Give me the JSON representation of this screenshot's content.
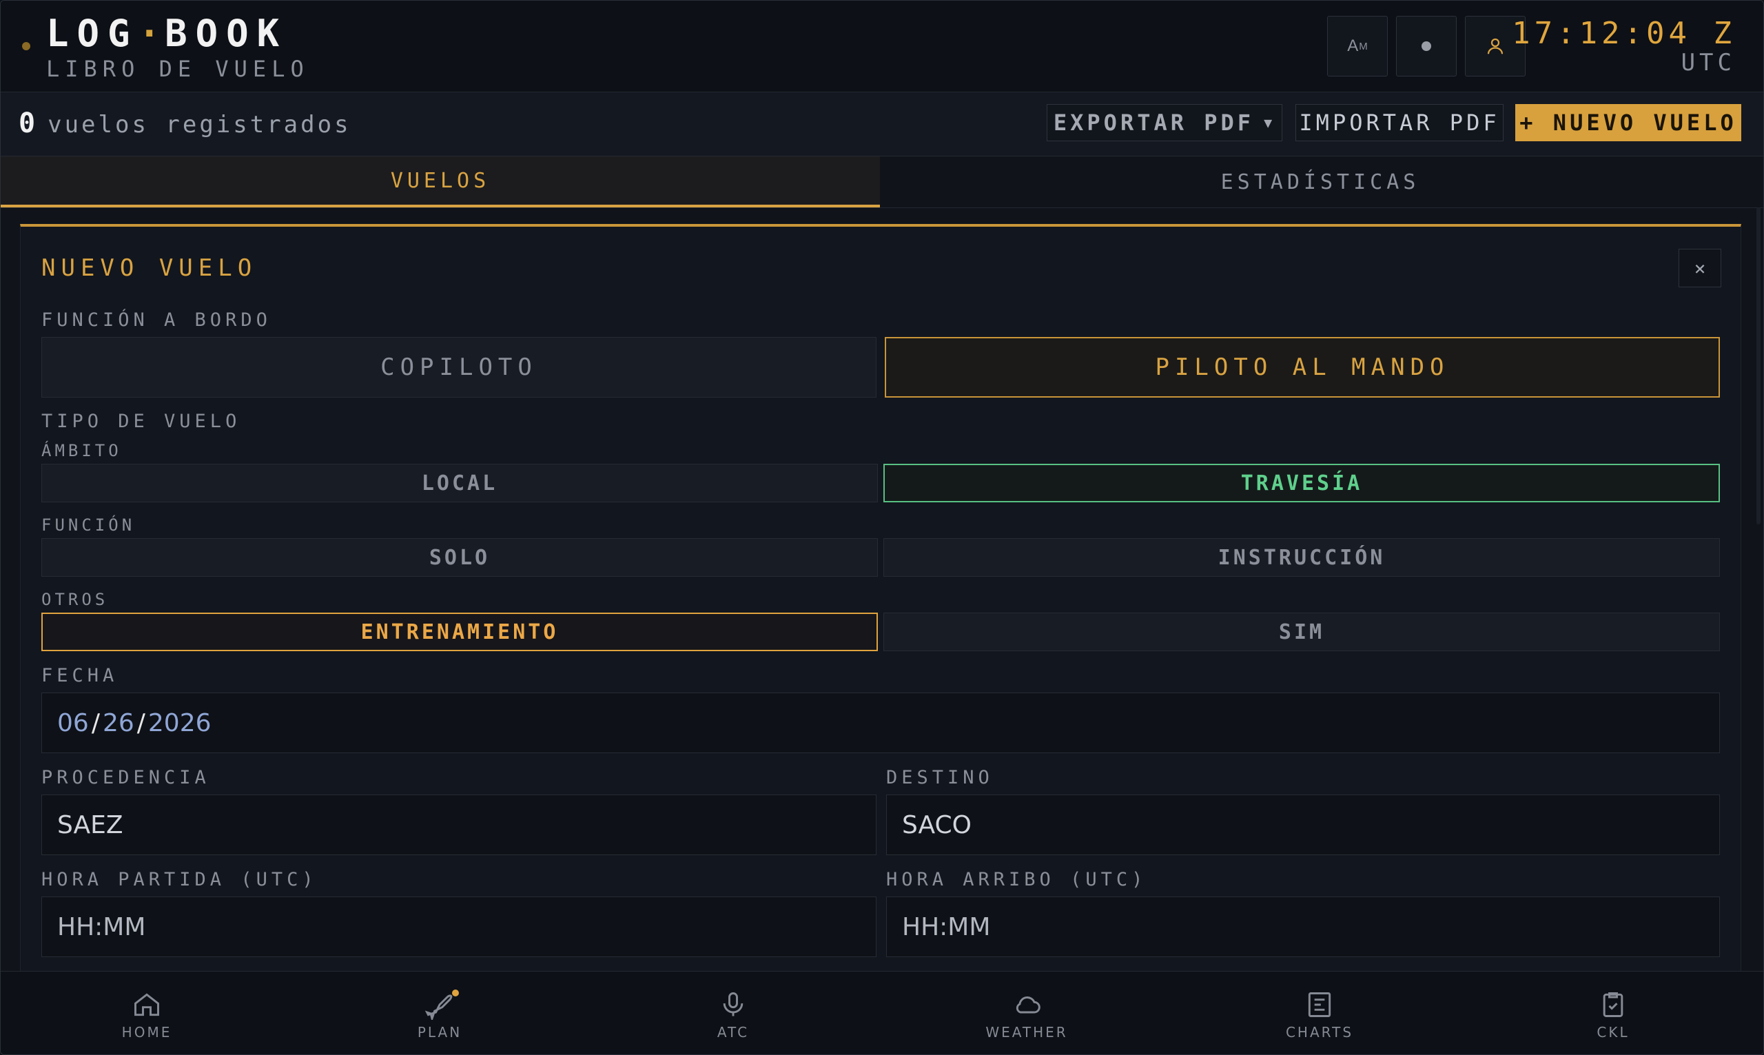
{
  "header": {
    "title_left": "LOG",
    "title_sep": "·",
    "title_right": "BOOK",
    "subtitle": "LIBRO DE VUELO",
    "font_button": {
      "big": "A",
      "small": "M"
    },
    "clock": "17:12:04 Z",
    "clock_zone": "UTC"
  },
  "toolbar": {
    "count": "0",
    "count_label": "vuelos registrados",
    "export_label": "EXPORTAR PDF",
    "export_caret": "▼",
    "import_label": "IMPORTAR PDF",
    "new_label": "+ NUEVO VUELO"
  },
  "tabs": [
    {
      "label": "VUELOS",
      "active": true
    },
    {
      "label": "ESTADÍSTICAS",
      "active": false
    }
  ],
  "form": {
    "title": "NUEVO VUELO",
    "close": "×",
    "role_label": "FUNCIÓN A BORDO",
    "roles": [
      {
        "label": "COPILOTO",
        "selected": false
      },
      {
        "label": "PILOTO AL MANDO",
        "selected": true
      }
    ],
    "flight_type_label": "TIPO DE VUELO",
    "scope_label": "ÁMBITO",
    "scope": [
      {
        "label": "LOCAL",
        "selected": false
      },
      {
        "label": "TRAVESÍA",
        "selected": true
      }
    ],
    "function_label": "FUNCIÓN",
    "function": [
      {
        "label": "SOLO",
        "selected": false
      },
      {
        "label": "INSTRUCCIÓN",
        "selected": false
      }
    ],
    "others_label": "OTROS",
    "others": [
      {
        "label": "ENTRENAMIENTO",
        "selected": true
      },
      {
        "label": "SIM",
        "selected": false
      }
    ],
    "date_label": "FECHA",
    "date": {
      "month": "06",
      "day": "26",
      "year": "2026",
      "sep": "/"
    },
    "origin_label": "PROCEDENCIA",
    "origin_value": "SAEZ",
    "destination_label": "DESTINO",
    "destination_value": "SACO",
    "departure_label": "HORA PARTIDA (UTC)",
    "departure_placeholder": "HH:MM",
    "arrival_label": "HORA ARRIBO (UTC)",
    "arrival_placeholder": "HH:MM"
  },
  "nav": [
    {
      "label": "HOME",
      "icon": "home-icon"
    },
    {
      "label": "PLAN",
      "icon": "plane-icon"
    },
    {
      "label": "ATC",
      "icon": "microphone-icon"
    },
    {
      "label": "WEATHER",
      "icon": "cloud-icon"
    },
    {
      "label": "CHARTS",
      "icon": "chart-document-icon"
    },
    {
      "label": "CKL",
      "icon": "checklist-icon"
    }
  ],
  "colors": {
    "accent": "#d9a342",
    "selected_green": "#5fd08c",
    "selected_orange": "#eba847",
    "background": "#10131a"
  }
}
